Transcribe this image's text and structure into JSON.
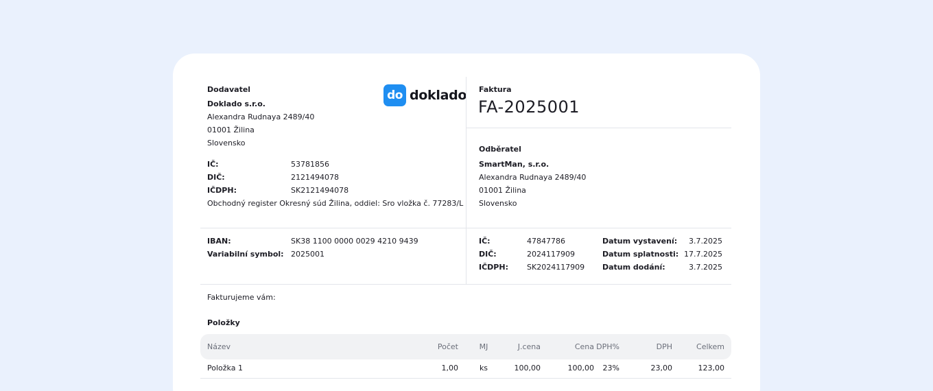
{
  "supplier": {
    "heading": "Dodavatel",
    "name": "Doklado s.r.o.",
    "street": "Alexandra Rudnaya 2489/40",
    "city": "01001 Žilina",
    "country": "Slovensko",
    "ico_label": "IČ:",
    "ico": "53781856",
    "dic_label": "DIČ:",
    "dic": "2121494078",
    "icdph_label": "IČDPH:",
    "icdph": "SK2121494078",
    "register": "Obchodný register Okresný súd Žilina, oddiel: Sro vložka č. 77283/L"
  },
  "logo": {
    "badge": "do",
    "word": "doklado",
    "color": "#1f8ef1"
  },
  "invoice": {
    "heading": "Faktura",
    "number": "FA-2025001"
  },
  "customer": {
    "heading": "Odběratel",
    "name": "SmartMan, s.r.o.",
    "street": "Alexandra Rudnaya 2489/40",
    "city": "01001 Žilina",
    "country": "Slovensko",
    "ico_label": "IČ:",
    "ico": "47847786",
    "dic_label": "DIČ:",
    "dic": "2024117909",
    "icdph_label": "IČDPH:",
    "icdph": "SK2024117909"
  },
  "payment": {
    "iban_label": "IBAN:",
    "iban": "SK38 1100 0000 0029 4210 9439",
    "vs_label": "Variabilní symbol:",
    "vs": "2025001"
  },
  "dates": {
    "issued_label": "Datum vystavení:",
    "issued": "3.7.2025",
    "due_label": "Datum splatnosti:",
    "due": "17.7.2025",
    "delivery_label": "Datum dodání:",
    "delivery": "3.7.2025"
  },
  "intro": "Fakturujeme vám:",
  "items_heading": "Položky",
  "table": {
    "columns": [
      "Název",
      "Počet",
      "MJ",
      "J.cena",
      "Cena",
      "DPH%",
      "DPH",
      "Celkem"
    ],
    "rows": [
      [
        "Položka 1",
        "1,00",
        "ks",
        "100,00",
        "100,00",
        "23%",
        "23,00",
        "123,00"
      ]
    ]
  }
}
